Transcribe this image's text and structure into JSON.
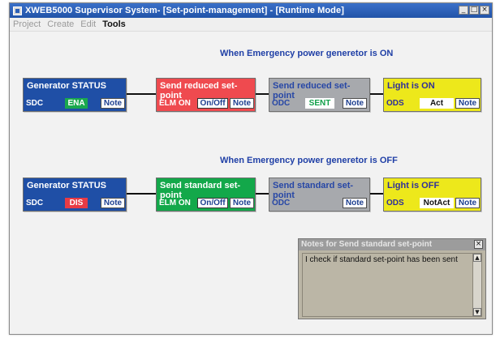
{
  "window": {
    "title": "XWEB5000 Supervisor System- [Set-point-management] - [Runtime Mode]",
    "controls": [
      "_",
      "□",
      "×"
    ]
  },
  "menu": {
    "items": [
      {
        "label": "Project",
        "active": false
      },
      {
        "label": "Create",
        "active": false
      },
      {
        "label": "Edit",
        "active": false
      },
      {
        "label": "Tools",
        "active": true
      }
    ]
  },
  "sections": [
    {
      "title": "When Emergency power generetor is ON",
      "blocks": [
        {
          "title": "Generator STATUS",
          "tag": "SDC",
          "value": "ENA",
          "note": "Note",
          "color": "#1f4fa6",
          "value_color": "#1aa84e"
        },
        {
          "title": "Send reduced set-point",
          "tag": "ELM ON",
          "value": "On/Off",
          "note": "Note",
          "color": "#ef4a4f"
        },
        {
          "title": "Send reduced set-point",
          "tag": "ODC",
          "value": "SENT",
          "note": "Note",
          "color": "#a7a9ad",
          "value_color": "#12a04a"
        },
        {
          "title": "Light is ON",
          "tag": "ODS",
          "value": "Act",
          "note": "Note",
          "color": "#ede81b"
        }
      ]
    },
    {
      "title": "When Emergency power generetor is OFF",
      "blocks": [
        {
          "title": "Generator STATUS",
          "tag": "SDC",
          "value": "DIS",
          "note": "Note",
          "color": "#1f4fa6",
          "value_color": "#e83b45"
        },
        {
          "title": "Send standard set-point",
          "tag": "ELM ON",
          "value": "On/Off",
          "note": "Note",
          "color": "#13a84a"
        },
        {
          "title": "Send standard set-point",
          "tag": "ODC",
          "value": "",
          "note": "Note",
          "color": "#a7a9ad"
        },
        {
          "title": "Light is OFF",
          "tag": "ODS",
          "value": "NotAct",
          "note": "Note",
          "color": "#ede81b"
        }
      ]
    }
  ],
  "notes_popup": {
    "title": "Notes for Send standard set-point",
    "text": "I check if standard set-point has been sent",
    "close": "×"
  }
}
